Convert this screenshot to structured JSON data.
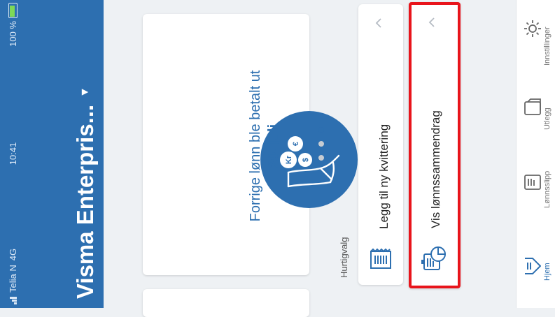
{
  "status_bar": {
    "carrier": "Telia N",
    "network": "4G",
    "time": "10:41",
    "battery": "100 %"
  },
  "header": {
    "title": "Visma Enterpris...",
    "dropdown_icon": "caret-down-icon"
  },
  "carousel": {
    "card_line1": "Forrige lønn ble betalt ut",
    "card_line2": "20. juli",
    "coin_labels": [
      "€",
      "Kr",
      "$"
    ],
    "pages": 3,
    "active_page": 1
  },
  "quick": {
    "label": "Hurtigvalg",
    "items": [
      {
        "label": "Legg til ny kvittering",
        "icon": "receipt-icon"
      },
      {
        "label": "Vis lønnssammendrag",
        "icon": "payslip-chart-icon"
      }
    ]
  },
  "nav": {
    "items": [
      {
        "label": "Hjem",
        "icon": "home-icon"
      },
      {
        "label": "Lønnsslipp",
        "icon": "payslip-icon"
      },
      {
        "label": "Utlegg",
        "icon": "expense-icon"
      },
      {
        "label": "Innstillinger",
        "icon": "gear-icon"
      }
    ]
  },
  "colors": {
    "brand": "#2d6fb0",
    "highlight": "#e8141b"
  }
}
